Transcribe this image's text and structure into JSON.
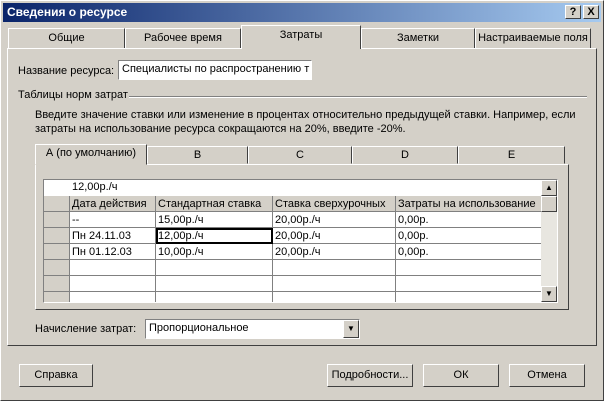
{
  "window": {
    "title": "Сведения о ресурсе"
  },
  "titlebar_buttons": {
    "help": "?",
    "close": "X"
  },
  "tabs": [
    {
      "label": "Общие"
    },
    {
      "label": "Рабочее время"
    },
    {
      "label": "Затраты",
      "active": true
    },
    {
      "label": "Заметки"
    },
    {
      "label": "Настраиваемые поля"
    }
  ],
  "resource_name": {
    "label": "Название ресурса:",
    "value": "Специалисты по распространению т"
  },
  "cost_tables": {
    "group_label": "Таблицы норм затрат",
    "hint": "Введите значение ставки или изменение в процентах относительно предыдущей ставки. Например, если затраты на использование ресурса сокращаются на 20%, введите -20%."
  },
  "rate_tabs": [
    {
      "label": "А (по умолчанию)",
      "active": true
    },
    {
      "label": "B"
    },
    {
      "label": "C"
    },
    {
      "label": "D"
    },
    {
      "label": "E"
    }
  ],
  "grid": {
    "edit_value": "12,00р./ч",
    "columns": [
      "Дата действия",
      "Стандартная ставка",
      "Ставка сверхурочных",
      "Затраты на использование"
    ],
    "rows": [
      [
        "--",
        "15,00р./ч",
        "20,00р./ч",
        "0,00р."
      ],
      [
        "Пн 24.11.03",
        "12,00р./ч",
        "20,00р./ч",
        "0,00р."
      ],
      [
        "Пн 01.12.03",
        "10,00р./ч",
        "20,00р./ч",
        "0,00р."
      ],
      [
        "",
        "",
        "",
        ""
      ],
      [
        "",
        "",
        "",
        ""
      ],
      [
        "",
        "",
        "",
        ""
      ]
    ]
  },
  "accrual": {
    "label": "Начисление затрат:",
    "value": "Пропорциональное"
  },
  "buttons": {
    "help": "Справка",
    "details": "Подробности...",
    "ok": "ОК",
    "cancel": "Отмена"
  }
}
